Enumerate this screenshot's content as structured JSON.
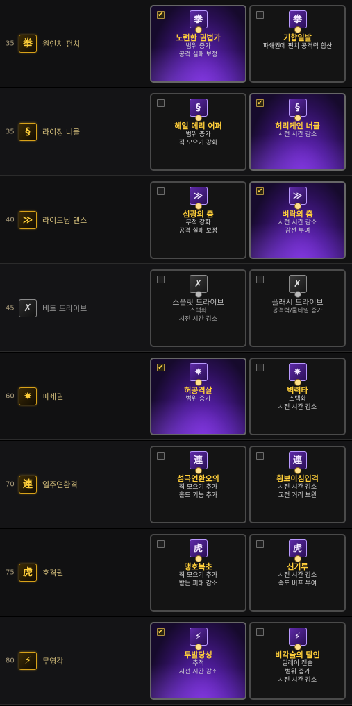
{
  "rows": [
    {
      "level": "35",
      "name": "원인치 펀치",
      "icon": "fist-icon",
      "glyph": "拳",
      "muted": false,
      "tripods": [
        {
          "title": "노련한 권법가",
          "lines": [
            "범위 증가",
            "공격 실패 보정"
          ],
          "selected": true,
          "muted": false,
          "icon": "fist-icon",
          "glyph": "拳"
        },
        {
          "title": "기합일발",
          "lines": [
            "파쇄권에 펀치 공격력 합산"
          ],
          "selected": false,
          "muted": false,
          "icon": "fist-icon",
          "glyph": "拳"
        }
      ]
    },
    {
      "level": "35",
      "name": "라이징 너클",
      "icon": "swirl-icon",
      "glyph": "§",
      "muted": false,
      "tripods": [
        {
          "title": "헤일 메리 어퍼",
          "lines": [
            "범위 증가",
            "적 모으기 강화"
          ],
          "selected": false,
          "muted": false,
          "icon": "swirl-icon",
          "glyph": "§"
        },
        {
          "title": "허리케인 너클",
          "lines": [
            "시전 시간 감소"
          ],
          "selected": true,
          "muted": false,
          "icon": "swirl-icon",
          "glyph": "§"
        }
      ]
    },
    {
      "level": "40",
      "name": "라이트닝 댄스",
      "icon": "lightning-icon",
      "glyph": "≫",
      "muted": false,
      "tripods": [
        {
          "title": "섬광의 춤",
          "lines": [
            "무적 강화",
            "공격 실패 보정"
          ],
          "selected": false,
          "muted": false,
          "icon": "lightning-icon",
          "glyph": "≫"
        },
        {
          "title": "벼락의 춤",
          "lines": [
            "시전 시간 감소",
            "감전 부여"
          ],
          "selected": true,
          "muted": false,
          "icon": "lightning-icon",
          "glyph": "≫"
        }
      ]
    },
    {
      "level": "45",
      "name": "비트 드라이브",
      "icon": "kick-icon",
      "glyph": "✗",
      "muted": true,
      "tripods": [
        {
          "title": "스플릿 드라이브",
          "lines": [
            "스택화",
            "시전 시간 감소"
          ],
          "selected": false,
          "muted": true,
          "icon": "kick-icon",
          "glyph": "✗"
        },
        {
          "title": "플래시 드라이브",
          "lines": [
            "공격력/쿨타임 증가"
          ],
          "selected": false,
          "muted": true,
          "icon": "kick-icon",
          "glyph": "✗"
        }
      ]
    },
    {
      "level": "60",
      "name": "파쇄권",
      "icon": "burst-icon",
      "glyph": "✸",
      "muted": false,
      "tripods": [
        {
          "title": "허공격살",
          "lines": [
            "범위 증가"
          ],
          "selected": true,
          "muted": false,
          "icon": "burst-icon",
          "glyph": "✸"
        },
        {
          "title": "벽력타",
          "lines": [
            "스택화",
            "시전 시간 감소"
          ],
          "selected": false,
          "muted": false,
          "icon": "burst-icon",
          "glyph": "✸"
        }
      ]
    },
    {
      "level": "70",
      "name": "일주연환격",
      "icon": "chain-glyph-icon",
      "glyph": "連",
      "muted": false,
      "tripods": [
        {
          "title": "섬극연환오의",
          "lines": [
            "적 모으기 추가",
            "홀드 기능 추가"
          ],
          "selected": false,
          "muted": false,
          "icon": "chain-glyph-icon",
          "glyph": "連"
        },
        {
          "title": "횡보이심입격",
          "lines": [
            "시전 시간 감소",
            "교전 거리 보완"
          ],
          "selected": false,
          "muted": false,
          "icon": "chain-glyph-icon",
          "glyph": "連"
        }
      ]
    },
    {
      "level": "75",
      "name": "호격권",
      "icon": "tiger-glyph-icon",
      "glyph": "虎",
      "muted": false,
      "tripods": [
        {
          "title": "맹호복초",
          "lines": [
            "적 모으기 추가",
            "받는 피해 감소"
          ],
          "selected": false,
          "muted": false,
          "icon": "tiger-glyph-icon",
          "glyph": "虎"
        },
        {
          "title": "신기루",
          "lines": [
            "시전 시간 감소",
            "속도 버프 부여"
          ],
          "selected": false,
          "muted": false,
          "icon": "tiger-glyph-icon",
          "glyph": "虎"
        }
      ]
    },
    {
      "level": "80",
      "name": "무영각",
      "icon": "shadow-kick-icon",
      "glyph": "⚡",
      "muted": false,
      "tripods": [
        {
          "title": "두발당성",
          "lines": [
            "추적",
            "시전 시간 감소"
          ],
          "selected": true,
          "muted": false,
          "icon": "shadow-kick-icon",
          "glyph": "⚡"
        },
        {
          "title": "비각술의 달인",
          "lines": [
            "딜레이 캔슬",
            "범위 증가",
            "시전 시간 감소"
          ],
          "selected": false,
          "muted": false,
          "icon": "shadow-kick-icon",
          "glyph": "⚡"
        }
      ]
    }
  ]
}
